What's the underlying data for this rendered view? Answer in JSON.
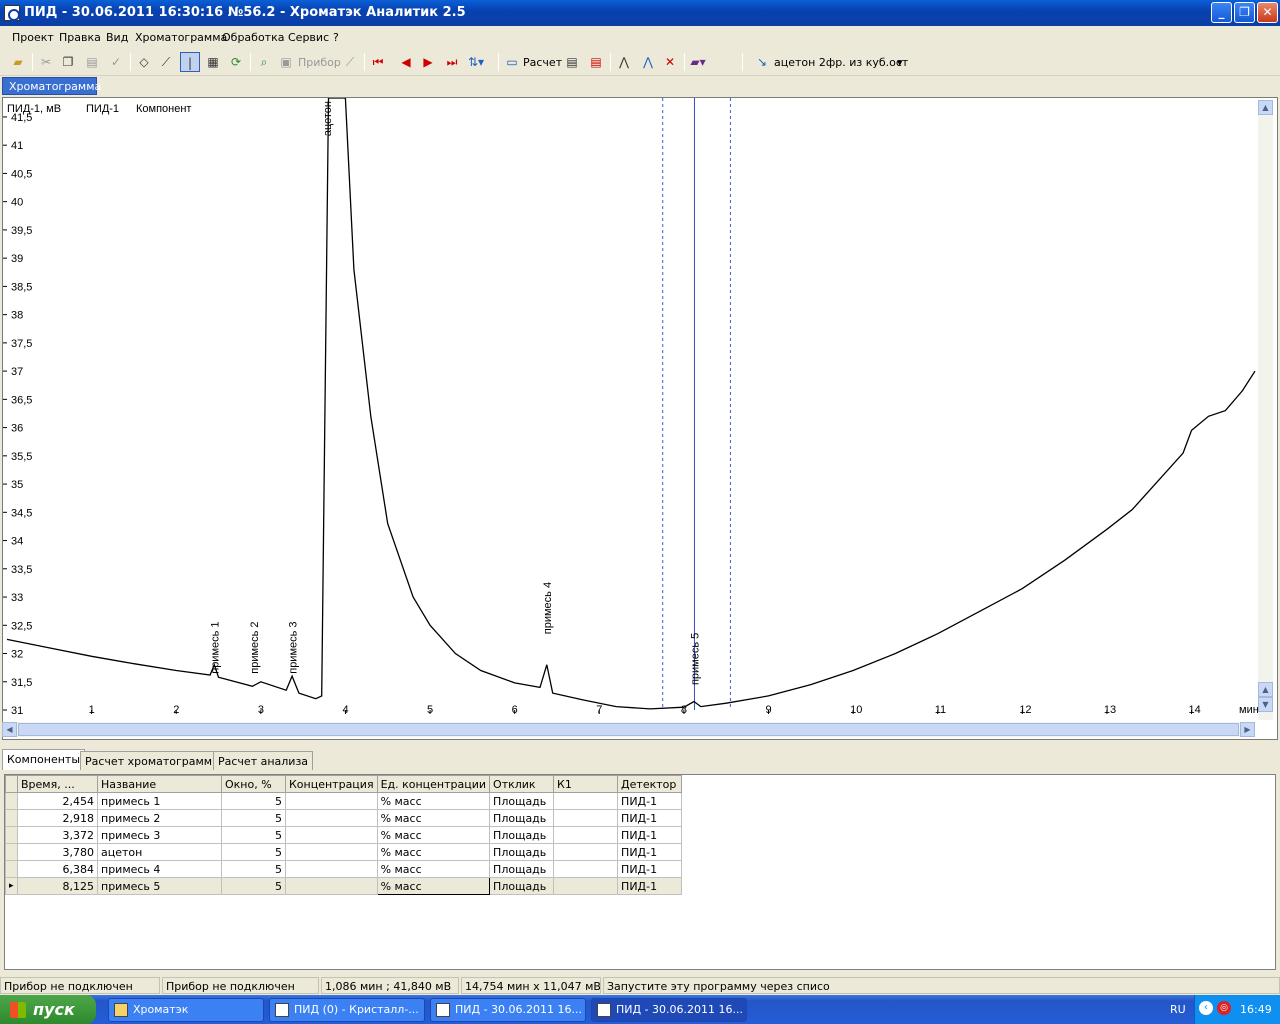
{
  "window": {
    "title": "ПИД - 30.06.2011 16:30:16 №56.2 - Хроматэк Аналитик 2.5"
  },
  "menu": [
    "Проект",
    "Правка",
    "Вид",
    "Хроматограмма",
    "Обработка",
    "Сервис",
    "?"
  ],
  "toolbar": {
    "instrument_label": "Прибор",
    "calc_label": "Расчет",
    "method_label": "ацетон 2фр. из куб.ост"
  },
  "chart_tab": "Хроматограмма",
  "chart_data": {
    "type": "line",
    "header_labels": [
      "ПИД-1, мВ",
      "ПИД-1",
      "Компонент"
    ],
    "xlabel": "мин",
    "xlim": [
      0,
      14.75
    ],
    "ylim": [
      31,
      41.8
    ],
    "x_ticks": [
      1,
      2,
      3,
      4,
      5,
      6,
      7,
      8,
      9,
      10,
      11,
      12,
      13,
      14
    ],
    "y_ticks": [
      "41,5",
      "41",
      "40,5",
      "40",
      "39,5",
      "39",
      "38,5",
      "38",
      "37,5",
      "37",
      "36,5",
      "36",
      "35,5",
      "35",
      "34,5",
      "34",
      "33,5",
      "33",
      "32,5",
      "32",
      "31,5",
      "31"
    ],
    "peak_labels": [
      {
        "name": "примесь 1",
        "time": 2.454
      },
      {
        "name": "примесь 2",
        "time": 2.918
      },
      {
        "name": "примесь 3",
        "time": 3.372
      },
      {
        "name": "ацетон",
        "time": 3.78
      },
      {
        "name": "примесь 4",
        "time": 6.384
      },
      {
        "name": "примесь 5",
        "time": 8.125
      }
    ],
    "series": [
      {
        "x": [
          0,
          0.5,
          1,
          1.5,
          2,
          2.4,
          2.45,
          2.5,
          2.9,
          3.0,
          3.3,
          3.37,
          3.45,
          3.65,
          3.72,
          3.8,
          4.0,
          4.1,
          4.3,
          4.5,
          4.8,
          5.0,
          5.3,
          5.6,
          6.0,
          6.3,
          6.38,
          6.45,
          6.8,
          7.2,
          7.6,
          8.0,
          8.12,
          8.2,
          8.5,
          9.0,
          9.5,
          10.0,
          10.5,
          11.0,
          11.5,
          12.0,
          12.5,
          13.0,
          13.3,
          13.6,
          13.9,
          14.0,
          14.2,
          14.4,
          14.6,
          14.75
        ],
        "y": [
          32.25,
          32.1,
          31.95,
          31.82,
          31.7,
          31.62,
          31.8,
          31.58,
          31.42,
          31.5,
          31.35,
          31.6,
          31.3,
          31.2,
          31.25,
          42,
          42,
          38.8,
          36.2,
          34.3,
          33.0,
          32.5,
          32.0,
          31.7,
          31.48,
          31.4,
          31.8,
          31.3,
          31.18,
          31.06,
          31.02,
          31.05,
          31.15,
          31.06,
          31.12,
          31.25,
          31.45,
          31.7,
          32.0,
          32.35,
          32.75,
          33.15,
          33.65,
          34.2,
          34.55,
          35.05,
          35.55,
          35.95,
          36.2,
          36.3,
          36.65,
          37.0
        ]
      }
    ],
    "cursor_time": 8.125,
    "marker_window": [
      7.75,
      8.55
    ]
  },
  "bottom_tabs": [
    "Компоненты",
    "Расчет хроматограммы",
    "Расчет анализа"
  ],
  "table": {
    "columns": [
      "Время, ...",
      "Название",
      "Окно, %",
      "Концентрация",
      "Ед. концентрации",
      "Отклик",
      "К1",
      "Детектор"
    ],
    "rows": [
      [
        "2,454",
        "примесь 1",
        "5",
        "",
        "% масс",
        "Площадь",
        "",
        "ПИД-1"
      ],
      [
        "2,918",
        "примесь 2",
        "5",
        "",
        "% масс",
        "Площадь",
        "",
        "ПИД-1"
      ],
      [
        "3,372",
        "примесь 3",
        "5",
        "",
        "% масс",
        "Площадь",
        "",
        "ПИД-1"
      ],
      [
        "3,780",
        "ацетон",
        "5",
        "",
        "% масс",
        "Площадь",
        "",
        "ПИД-1"
      ],
      [
        "6,384",
        "примесь 4",
        "5",
        "",
        "% масс",
        "Площадь",
        "",
        "ПИД-1"
      ],
      [
        "8,125",
        "примесь 5",
        "5",
        "",
        "% масс",
        "Площадь",
        "",
        "ПИД-1"
      ]
    ]
  },
  "status": [
    "Прибор не подключен",
    "Прибор не подключен",
    "1,086 мин ; 41,840 мВ",
    "14,754 мин x 11,047 мВ",
    "Запустите эту программу через списо"
  ],
  "taskbar": {
    "start": "пуск",
    "tasks": [
      "Хроматэк",
      "ПИД (0) - Кристалл-...",
      "ПИД - 30.06.2011 16...",
      "ПИД - 30.06.2011 16..."
    ],
    "lang": "RU",
    "time": "16:49"
  }
}
